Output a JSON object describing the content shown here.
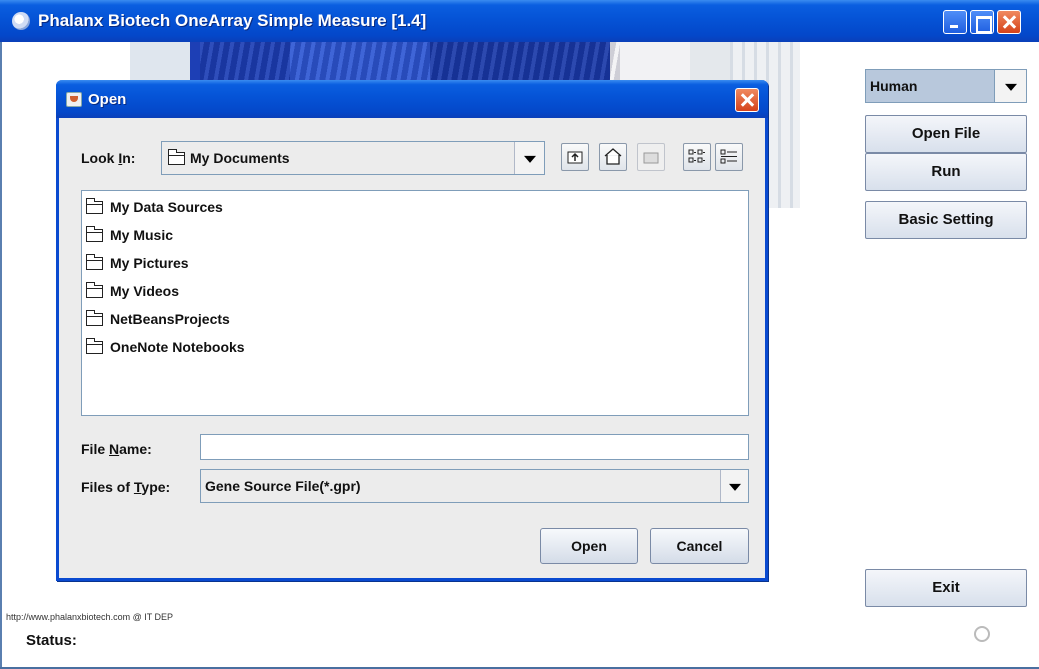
{
  "window": {
    "title": "Phalanx Biotech OneArray Simple Measure [1.4]"
  },
  "right_panel": {
    "species_value": "Human",
    "open_file_label": "Open File",
    "run_label": "Run",
    "basic_setting_label": "Basic Setting",
    "exit_label": "Exit"
  },
  "footer": {
    "url_text": "http://www.phalanxbiotech.com  @  IT DEP",
    "status_label": "Status:"
  },
  "dialog": {
    "title": "Open",
    "look_in_prefix": "Look ",
    "look_in_key": "I",
    "look_in_suffix": "n:",
    "look_in_value": "My Documents",
    "items": [
      {
        "name": "My Data Sources"
      },
      {
        "name": "My Music"
      },
      {
        "name": "My Pictures"
      },
      {
        "name": "My Videos"
      },
      {
        "name": "NetBeansProjects"
      },
      {
        "name": "OneNote Notebooks"
      }
    ],
    "file_name_prefix": "File ",
    "file_name_key": "N",
    "file_name_suffix": "ame:",
    "file_name_value": "",
    "files_of_type_prefix": "Files of ",
    "files_of_type_key": "T",
    "files_of_type_suffix": "ype:",
    "files_of_type_value": "Gene Source File(*.gpr)",
    "open_label": "Open",
    "cancel_label": "Cancel"
  }
}
